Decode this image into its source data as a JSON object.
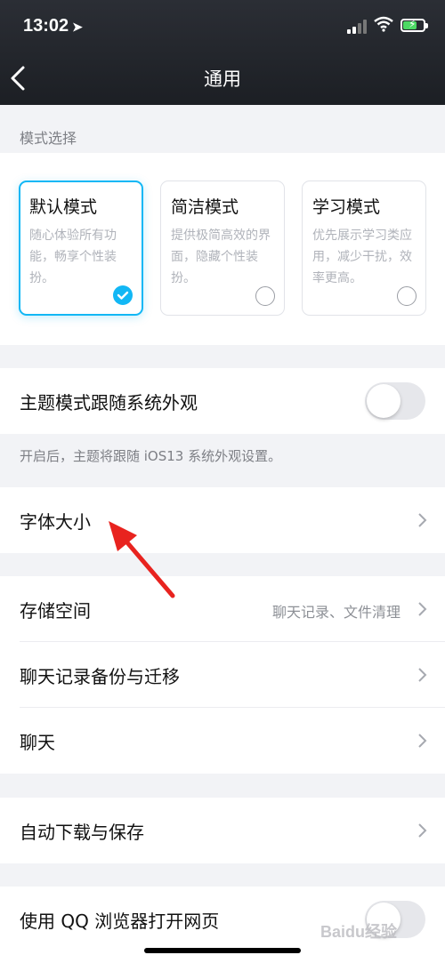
{
  "status_bar": {
    "time": "13:02",
    "location_icon": "location-arrow-icon",
    "battery_color": "#4cd964"
  },
  "nav": {
    "title": "通用",
    "back_icon": "chevron-left-icon"
  },
  "mode_section": {
    "label": "模式选择",
    "modes": [
      {
        "name": "默认模式",
        "desc": "随心体验所有功能，畅享个性装扮。",
        "selected": true
      },
      {
        "name": "简洁模式",
        "desc": "提供极简高效的界面，隐藏个性装扮。",
        "selected": false
      },
      {
        "name": "学习模式",
        "desc": "优先展示学习类应用，减少干扰，效率更高。",
        "selected": false
      }
    ]
  },
  "theme_follow": {
    "label": "主题模式跟随系统外观",
    "enabled": false,
    "hint": "开启后，主题将跟随 iOS13 系统外观设置。"
  },
  "font_size": {
    "label": "字体大小"
  },
  "storage": {
    "label": "存储空间",
    "value": "聊天记录、文件清理"
  },
  "chat_backup": {
    "label": "聊天记录备份与迁移"
  },
  "chat": {
    "label": "聊天"
  },
  "auto_download": {
    "label": "自动下载与保存"
  },
  "qq_browser": {
    "label": "使用 QQ 浏览器打开网页",
    "enabled": false
  },
  "watermark": {
    "text": "Baidu经验"
  },
  "colors": {
    "accent": "#12b7f5",
    "annotation": "#e8231f",
    "header_bg": "#1f2227"
  }
}
